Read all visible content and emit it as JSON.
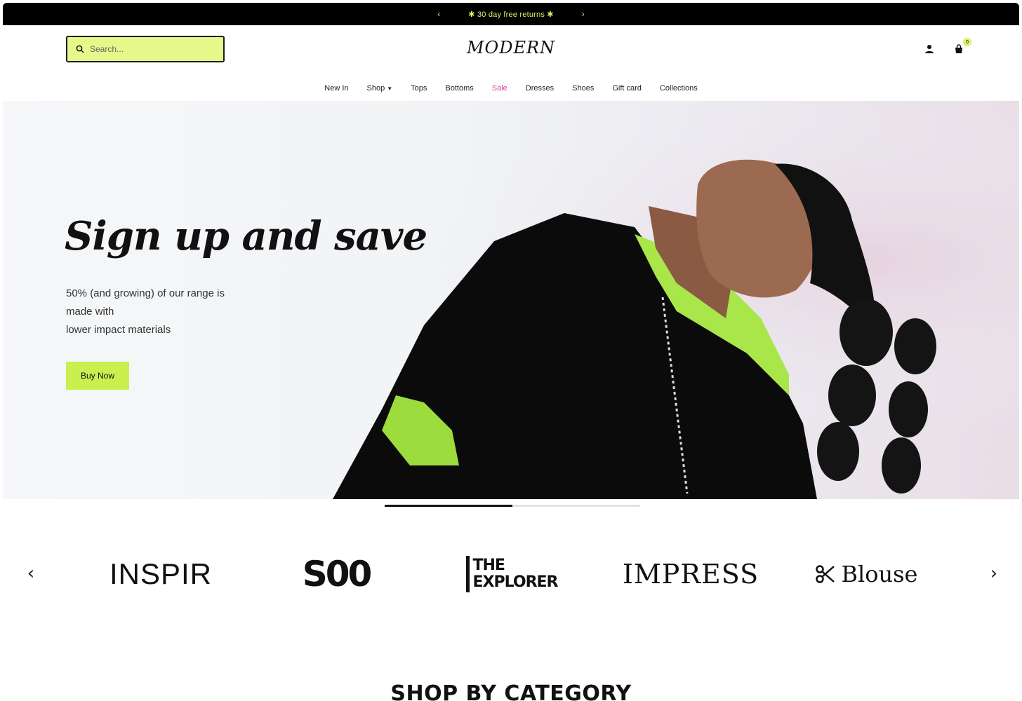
{
  "announcement": {
    "prev_icon": "chevron-left-icon",
    "next_icon": "chevron-right-icon",
    "message": "✱ 30 day free returns ✱"
  },
  "header": {
    "search_placeholder": "Search...",
    "logo": "MODERN",
    "cart_count": "0",
    "account_icon": "user-icon",
    "cart_icon": "shopping-bag-icon"
  },
  "nav": {
    "items": [
      {
        "label": "New In"
      },
      {
        "label": "Shop",
        "dropdown": true
      },
      {
        "label": "Tops"
      },
      {
        "label": "Bottoms"
      },
      {
        "label": "Sale",
        "color": "#e33aa4"
      },
      {
        "label": "Dresses"
      },
      {
        "label": "Shoes"
      },
      {
        "label": "Gift card"
      },
      {
        "label": "Collections"
      }
    ]
  },
  "hero": {
    "title": "Sign up and save",
    "subtitle_line1": "50% (and growing) of our range is",
    "subtitle_line2": "made with",
    "subtitle_line3": "lower impact materials",
    "cta": "Buy Now",
    "slide_progress": 0.5
  },
  "brands": {
    "items": [
      "INSPIR",
      "S00",
      "THE EXPLORER",
      "IMPRESS",
      "Blouse"
    ],
    "explorer_line1": "THE",
    "explorer_line2": "EXPLORER"
  },
  "sections": {
    "shop_by_category": "SHOP BY CATEGORY"
  },
  "colors": {
    "accent": "#c9f04f",
    "search_bg": "#e4f98a",
    "sale": "#e33aa4",
    "announcement_bg": "#000000"
  }
}
